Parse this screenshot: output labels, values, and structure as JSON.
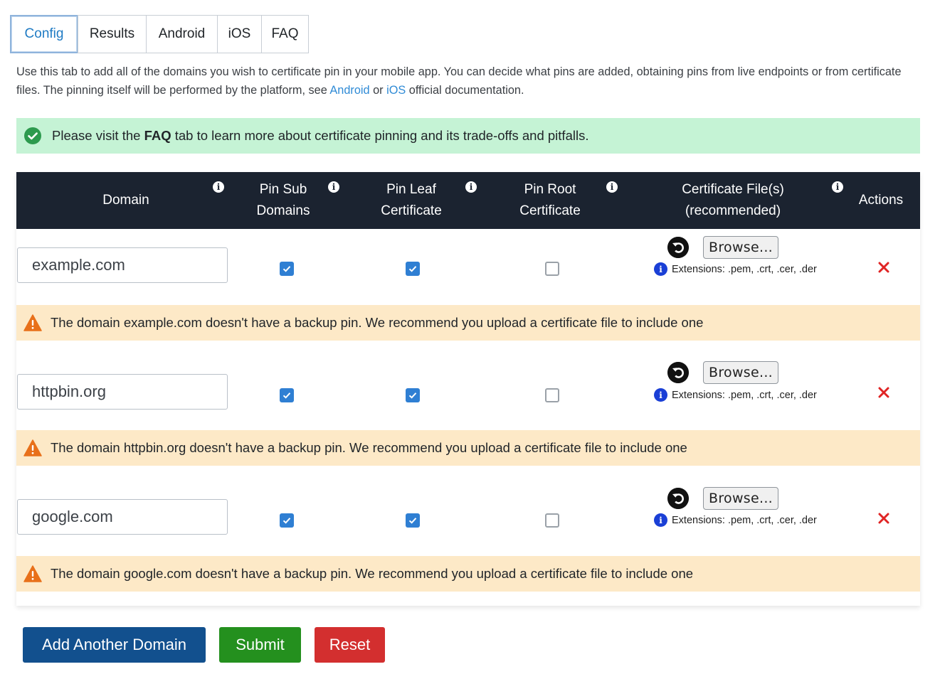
{
  "tabs": [
    {
      "label": "Config",
      "active": true
    },
    {
      "label": "Results",
      "active": false
    },
    {
      "label": "Android",
      "active": false
    },
    {
      "label": "iOS",
      "active": false
    },
    {
      "label": "FAQ",
      "active": false
    }
  ],
  "intro": {
    "text_before": "Use this tab to add all of the domains you wish to certificate pin in your mobile app. You can decide what pins are added, obtaining pins from live endpoints or from certificate files. The pinning itself will be performed by the platform, see ",
    "link_android": "Android",
    "text_or": " or ",
    "link_ios": "iOS",
    "text_after": " official documentation."
  },
  "success_banner": {
    "text_before": "Please visit the ",
    "bold": "FAQ",
    "text_after": " tab to learn more about certificate pinning and its trade-offs and pitfalls."
  },
  "table": {
    "headers": {
      "domain": "Domain",
      "pin_sub_1": "Pin Sub",
      "pin_sub_2": "Domains",
      "pin_leaf_1": "Pin Leaf",
      "pin_leaf_2": "Certificate",
      "pin_root_1": "Pin Root",
      "pin_root_2": "Certificate",
      "cert_1": "Certificate File(s)",
      "cert_2": "(recommended)",
      "actions": "Actions",
      "info_glyph": "i"
    },
    "rows": [
      {
        "domain": "example.com",
        "pin_sub": true,
        "pin_leaf": true,
        "pin_root": false,
        "browse_label": "Browse...",
        "extensions": "Extensions: .pem, .crt, .cer, .der",
        "delete_glyph": "×",
        "warning": "The domain example.com doesn't have a backup pin. We recommend you upload a certificate file to include one"
      },
      {
        "domain": "httpbin.org",
        "pin_sub": true,
        "pin_leaf": true,
        "pin_root": false,
        "browse_label": "Browse...",
        "extensions": "Extensions: .pem, .crt, .cer, .der",
        "delete_glyph": "×",
        "warning": "The domain httpbin.org doesn't have a backup pin. We recommend you upload a certificate file to include one"
      },
      {
        "domain": "google.com",
        "pin_sub": true,
        "pin_leaf": true,
        "pin_root": false,
        "browse_label": "Browse...",
        "extensions": "Extensions: .pem, .crt, .cer, .der",
        "delete_glyph": "×",
        "warning": "The domain google.com doesn't have a backup pin. We recommend you upload a certificate file to include one"
      }
    ]
  },
  "buttons": {
    "add": "Add Another Domain",
    "submit": "Submit",
    "reset": "Reset"
  },
  "colors": {
    "header_bg": "#1b2330",
    "success_bg": "#c5f3d5",
    "warning_bg": "#fde9c7",
    "checkbox_blue": "#2f7fd3",
    "add_button": "#12508e",
    "submit_button": "#24901e",
    "reset_button": "#d32f2f"
  },
  "icons": {
    "banner": "check-circle-icon",
    "warning": "warning-triangle-icon",
    "undo": "undo-icon",
    "info": "info-icon",
    "delete": "close-icon"
  }
}
